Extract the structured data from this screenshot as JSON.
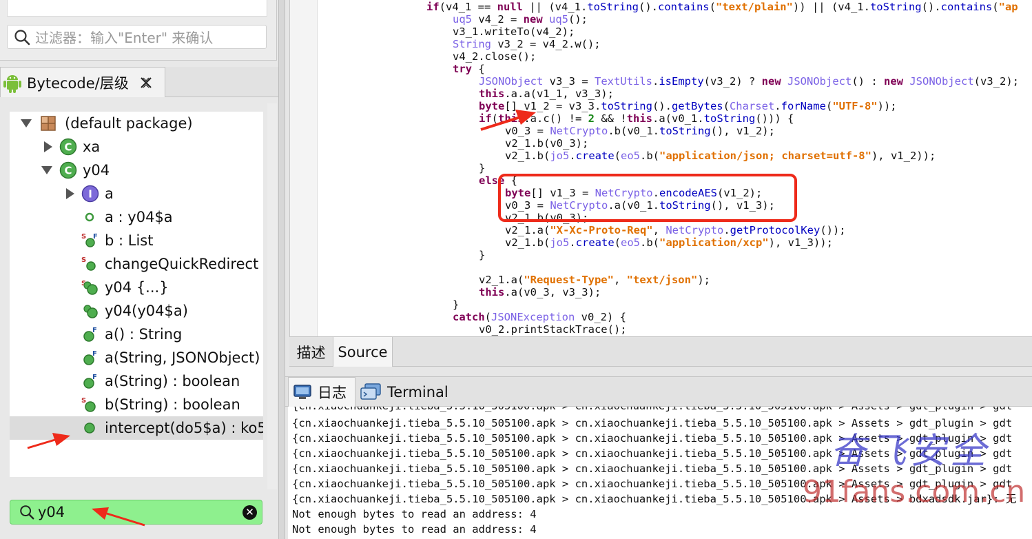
{
  "left_panel": {
    "filter_placeholder": "过滤器：输入\"Enter\" 来确认",
    "bytecode_tab_label": "Bytecode/层级",
    "tree": [
      {
        "label": "(default package)",
        "icon": "package-icon",
        "expanded": true
      },
      {
        "label": "xa",
        "icon": "class-icon",
        "expanded": false
      },
      {
        "label": "y04",
        "icon": "class-icon",
        "expanded": true
      },
      {
        "label": "a",
        "icon": "interface-icon",
        "expanded": false
      },
      {
        "label": "a : y04$a",
        "icon": "field-icon"
      },
      {
        "label": "b : List",
        "icon": "static-final-field-icon"
      },
      {
        "label": "changeQuickRedirect",
        "icon": "static-field-icon"
      },
      {
        "label": "y04 {...}",
        "icon": "static-constructor-icon"
      },
      {
        "label": "y04(y04$a)",
        "icon": "constructor-icon"
      },
      {
        "label": "a() : String",
        "icon": "final-method-icon"
      },
      {
        "label": "a(String, JSONObject)",
        "icon": "final-method-icon"
      },
      {
        "label": "a(String) : boolean",
        "icon": "final-method-icon"
      },
      {
        "label": "b(String) : boolean",
        "icon": "static-method-icon"
      },
      {
        "label": "intercept(do5$a) : ko5",
        "icon": "method-icon",
        "selected": true
      }
    ],
    "search_value": "y04"
  },
  "code": {
    "lines": [
      [
        [
          "kw",
          "if"
        ],
        [
          "",
          "(v4_1 == "
        ],
        [
          "kw",
          "null"
        ],
        [
          "",
          " || (v4_1."
        ],
        [
          "fld",
          "toString"
        ],
        [
          "",
          "()."
        ],
        [
          "fld",
          "contains"
        ],
        [
          "",
          "("
        ],
        [
          "str",
          "\"text/plain\""
        ],
        [
          "",
          "))"
        ],
        [
          "",
          " || (v4_1."
        ],
        [
          "fld",
          "toString"
        ],
        [
          "",
          "()."
        ],
        [
          "fld",
          "contains"
        ],
        [
          "",
          "("
        ],
        [
          "str",
          "\"ap"
        ]
      ],
      [
        [
          "ty",
          "uq5"
        ],
        [
          "",
          " v4_2 = "
        ],
        [
          "kw",
          "new"
        ],
        [
          "",
          " "
        ],
        [
          "ty",
          "uq5"
        ],
        [
          "",
          "();"
        ]
      ],
      [
        [
          "",
          "v3_1.writeTo(v4_2);"
        ]
      ],
      [
        [
          "ty",
          "String"
        ],
        [
          "",
          " v3_2 = v4_2.w();"
        ]
      ],
      [
        [
          "",
          "v4_2.close();"
        ]
      ],
      [
        [
          "kw",
          "try"
        ],
        [
          "",
          " {"
        ]
      ],
      [
        [
          "ty",
          "JSONObject"
        ],
        [
          "",
          " v3_3 = "
        ],
        [
          "ty",
          "TextUtils"
        ],
        [
          "",
          "."
        ],
        [
          "fld",
          "isEmpty"
        ],
        [
          "",
          "(v3_2) ? "
        ],
        [
          "kw",
          "new"
        ],
        [
          "",
          " "
        ],
        [
          "ty",
          "JSONObject"
        ],
        [
          "",
          "() : "
        ],
        [
          "kw",
          "new"
        ],
        [
          "",
          " "
        ],
        [
          "ty",
          "JSONObject"
        ],
        [
          "",
          "(v3_2);"
        ]
      ],
      [
        [
          "kw",
          "this"
        ],
        [
          "",
          ".a.a(v1_1, v3_3);"
        ]
      ],
      [
        [
          "kw",
          "byte"
        ],
        [
          "",
          "[] v1_2 = v3_3."
        ],
        [
          "fld",
          "toString"
        ],
        [
          "",
          "()."
        ],
        [
          "fld",
          "getBytes"
        ],
        [
          "",
          "("
        ],
        [
          "ty",
          "Charset"
        ],
        [
          "",
          "."
        ],
        [
          "fld",
          "forName"
        ],
        [
          "",
          "("
        ],
        [
          "str",
          "\"UTF-8\""
        ],
        [
          "",
          "));"
        ]
      ],
      [
        [
          "kw",
          "if"
        ],
        [
          "",
          "("
        ],
        [
          "kw",
          "this"
        ],
        [
          "",
          ".a.c() != "
        ],
        [
          "num",
          "2"
        ],
        [
          "",
          " && !"
        ],
        [
          "kw",
          "this"
        ],
        [
          "",
          ".a(v0_1."
        ],
        [
          "fld",
          "toString"
        ],
        [
          "",
          "())) {"
        ]
      ],
      [
        [
          "",
          "v0_3 = "
        ],
        [
          "ty",
          "NetCrypto"
        ],
        [
          "",
          ".b(v0_1."
        ],
        [
          "fld",
          "toString"
        ],
        [
          "",
          "(), v1_2);"
        ]
      ],
      [
        [
          "",
          "v2_1.b(v0_3);"
        ]
      ],
      [
        [
          "",
          "v2_1.b("
        ],
        [
          "ty",
          "jo5"
        ],
        [
          "",
          "."
        ],
        [
          "fld",
          "create"
        ],
        [
          "",
          "("
        ],
        [
          "ty",
          "eo5"
        ],
        [
          "",
          ".b("
        ],
        [
          "str",
          "\"application/json; charset=utf-8\""
        ],
        [
          "",
          "), v1_2));"
        ]
      ],
      [
        [
          "",
          "}"
        ]
      ],
      [
        [
          "kw",
          "else"
        ],
        [
          "",
          " {"
        ]
      ],
      [
        [
          "kw",
          "byte"
        ],
        [
          "",
          "[] v1_3 = "
        ],
        [
          "ty",
          "NetCrypto"
        ],
        [
          "",
          "."
        ],
        [
          "fld",
          "encodeAES"
        ],
        [
          "",
          "(v1_2);"
        ]
      ],
      [
        [
          "",
          "v0_3 = "
        ],
        [
          "ty",
          "NetCrypto"
        ],
        [
          "",
          ".a(v0_1."
        ],
        [
          "fld",
          "toString"
        ],
        [
          "",
          "(), v1_3);"
        ]
      ],
      [
        [
          "",
          "v2_1.b(v0_3);"
        ]
      ],
      [
        [
          "",
          "v2_1.a("
        ],
        [
          "str",
          "\"X-Xc-Proto-Req\""
        ],
        [
          "",
          ", "
        ],
        [
          "ty",
          "NetCrypto"
        ],
        [
          "",
          "."
        ],
        [
          "fld",
          "getProtocolKey"
        ],
        [
          "",
          "());"
        ]
      ],
      [
        [
          "",
          "v2_1.b("
        ],
        [
          "ty",
          "jo5"
        ],
        [
          "",
          "."
        ],
        [
          "fld",
          "create"
        ],
        [
          "",
          "("
        ],
        [
          "ty",
          "eo5"
        ],
        [
          "",
          ".b("
        ],
        [
          "str",
          "\"application/xcp\""
        ],
        [
          "",
          "), v1_3));"
        ]
      ],
      [
        [
          "",
          "}"
        ]
      ],
      [
        [
          "",
          ""
        ]
      ],
      [
        [
          "",
          "v2_1.a("
        ],
        [
          "str",
          "\"Request-Type\""
        ],
        [
          "",
          ", "
        ],
        [
          "str",
          "\"text/json\""
        ],
        [
          "",
          ");"
        ]
      ],
      [
        [
          "kw",
          "this"
        ],
        [
          "",
          ".a(v0_3, v3_3);"
        ]
      ],
      [
        [
          "",
          "}"
        ]
      ],
      [
        [
          "kw",
          "catch"
        ],
        [
          "",
          "("
        ],
        [
          "ty",
          "JSONException"
        ],
        [
          "",
          " v0_2) {"
        ]
      ],
      [
        [
          "",
          "v0_2.printStackTrace();"
        ]
      ]
    ]
  },
  "bottom_tabs": {
    "describe": "描述",
    "source": "Source"
  },
  "log_tabs": {
    "log": "日志",
    "terminal": "Terminal"
  },
  "log_lines": [
    "{cn.xiaochuankeji.tieba_5.5.10_505100.apk > cn.xiaochuankeji.tieba_5.5.10_505100.apk > Assets > gdt_plugin > gdt",
    "{cn.xiaochuankeji.tieba_5.5.10_505100.apk > cn.xiaochuankeji.tieba_5.5.10_505100.apk > Assets > gdt_plugin > gdt",
    "{cn.xiaochuankeji.tieba_5.5.10_505100.apk > cn.xiaochuankeji.tieba_5.5.10_505100.apk > Assets > gdt_plugin > gdt",
    "{cn.xiaochuankeji.tieba_5.5.10_505100.apk > cn.xiaochuankeji.tieba_5.5.10_505100.apk > Assets > gdt_plugin > gdt",
    "{cn.xiaochuankeji.tieba_5.5.10_505100.apk > cn.xiaochuankeji.tieba_5.5.10_505100.apk > Assets > gdt_plugin > gdt",
    "{cn.xiaochuankeji.tieba_5.5.10_505100.apk > cn.xiaochuankeji.tieba_5.5.10_505100.apk > Assets > bdxadsdk.jar}: 无",
    "Not enough bytes to read an address: 4",
    "Not enough bytes to read an address: 4"
  ],
  "watermark": {
    "cn": "奋飞安全",
    "url": "91fans.com.cn"
  },
  "colors": {
    "highlight": "#ee2a1a",
    "search_bg": "#8ef08e",
    "keyword": "#7f0055",
    "type": "#7b62e6",
    "string": "#e07000"
  }
}
